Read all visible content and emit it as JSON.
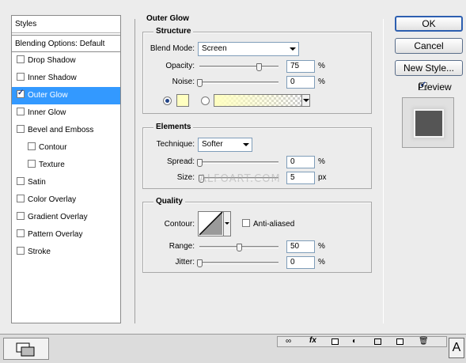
{
  "styles_list": {
    "header": "Styles",
    "blending": "Blending Options: Default",
    "items": [
      {
        "label": "Drop Shadow",
        "checked": false
      },
      {
        "label": "Inner Shadow",
        "checked": false
      },
      {
        "label": "Outer Glow",
        "checked": true,
        "selected": true
      },
      {
        "label": "Inner Glow",
        "checked": false
      },
      {
        "label": "Bevel and Emboss",
        "checked": false
      },
      {
        "label": "Contour",
        "checked": false,
        "indent": true
      },
      {
        "label": "Texture",
        "checked": false,
        "indent": true
      },
      {
        "label": "Satin",
        "checked": false
      },
      {
        "label": "Color Overlay",
        "checked": false
      },
      {
        "label": "Gradient Overlay",
        "checked": false
      },
      {
        "label": "Pattern Overlay",
        "checked": false
      },
      {
        "label": "Stroke",
        "checked": false
      }
    ]
  },
  "outer_glow": {
    "title": "Outer Glow",
    "structure": {
      "title": "Structure",
      "blend_mode_label": "Blend Mode:",
      "blend_mode_value": "Screen",
      "opacity_label": "Opacity:",
      "opacity_value": "75",
      "opacity_unit": "%",
      "opacity_level": 0.75,
      "noise_label": "Noise:",
      "noise_value": "0",
      "noise_unit": "%",
      "noise_level": 0,
      "glow_color": "#ffffc0"
    },
    "elements": {
      "title": "Elements",
      "technique_label": "Technique:",
      "technique_value": "Softer",
      "spread_label": "Spread:",
      "spread_value": "0",
      "spread_unit": "%",
      "spread_level": 0,
      "size_label": "Size:",
      "size_value": "5",
      "size_unit": "px",
      "size_level": 0.02
    },
    "quality": {
      "title": "Quality",
      "contour_label": "Contour:",
      "anti_aliased_label": "Anti-aliased",
      "anti_aliased_checked": false,
      "range_label": "Range:",
      "range_value": "50",
      "range_unit": "%",
      "range_level": 0.5,
      "jitter_label": "Jitter:",
      "jitter_value": "0",
      "jitter_unit": "%",
      "jitter_level": 0
    }
  },
  "buttons": {
    "ok": "OK",
    "cancel": "Cancel",
    "new_style": "New Style...",
    "preview_label": "Preview",
    "preview_checked": true
  },
  "watermark": "ALFOART.COM",
  "colors": {
    "selection": "#3399ff",
    "preview_swatch": "#555555"
  }
}
